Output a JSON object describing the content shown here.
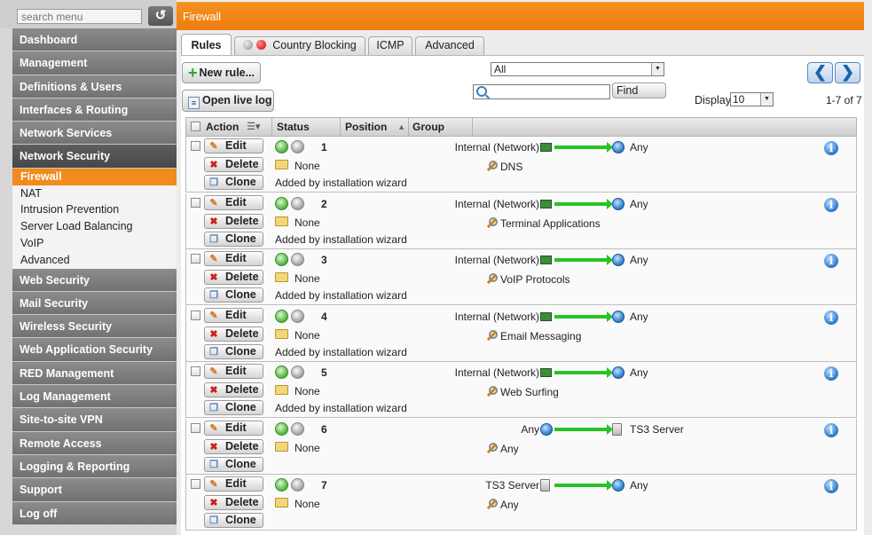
{
  "sidebar": {
    "search_placeholder": "search menu",
    "reset_glyph": "↺",
    "items": [
      {
        "label": "Dashboard"
      },
      {
        "label": "Management"
      },
      {
        "label": "Definitions & Users"
      },
      {
        "label": "Interfaces & Routing"
      },
      {
        "label": "Network Services"
      },
      {
        "label": "Network Security",
        "active": true
      },
      {
        "label": "Web Security"
      },
      {
        "label": "Mail Security"
      },
      {
        "label": "Wireless Security"
      },
      {
        "label": "Web Application Security"
      },
      {
        "label": "RED Management"
      },
      {
        "label": "Log Management"
      },
      {
        "label": "Site-to-site VPN"
      },
      {
        "label": "Remote Access"
      },
      {
        "label": "Logging & Reporting"
      },
      {
        "label": "Support"
      },
      {
        "label": "Log off"
      }
    ],
    "subitems": [
      {
        "label": "Firewall",
        "active": true
      },
      {
        "label": "NAT"
      },
      {
        "label": "Intrusion Prevention"
      },
      {
        "label": "Server Load Balancing"
      },
      {
        "label": "VoIP"
      },
      {
        "label": "Advanced"
      }
    ]
  },
  "page_title": "Firewall",
  "tabs": [
    {
      "label": "Rules",
      "active": true
    },
    {
      "label": "Country Blocking"
    },
    {
      "label": "ICMP"
    },
    {
      "label": "Advanced"
    }
  ],
  "toolbar": {
    "new_rule_label": "New rule...",
    "open_live_log_label": "Open live log",
    "filter_value": "All",
    "search_value": "",
    "find_label": "Find",
    "display_label": "Display:",
    "display_value": "10",
    "pager_range": "1-7 of 7",
    "prev_glyph": "❮",
    "next_glyph": "❯"
  },
  "table": {
    "headers": {
      "action": "Action",
      "status": "Status",
      "position": "Position",
      "group": "Group"
    },
    "row_buttons": {
      "edit": "Edit",
      "delete": "Delete",
      "clone": "Clone"
    },
    "rows": [
      {
        "position": "1",
        "group": "None",
        "source": "Internal (Network)",
        "source_icon": "network-card-icon",
        "destination": "Any",
        "destination_icon": "globe-icon",
        "service": "DNS",
        "note": "Added by installation wizard"
      },
      {
        "position": "2",
        "group": "None",
        "source": "Internal (Network)",
        "source_icon": "network-card-icon",
        "destination": "Any",
        "destination_icon": "globe-icon",
        "service": "Terminal Applications",
        "note": "Added by installation wizard"
      },
      {
        "position": "3",
        "group": "None",
        "source": "Internal (Network)",
        "source_icon": "network-card-icon",
        "destination": "Any",
        "destination_icon": "globe-icon",
        "service": "VoIP Protocols",
        "note": "Added by installation wizard"
      },
      {
        "position": "4",
        "group": "None",
        "source": "Internal (Network)",
        "source_icon": "network-card-icon",
        "destination": "Any",
        "destination_icon": "globe-icon",
        "service": "Email Messaging",
        "note": "Added by installation wizard"
      },
      {
        "position": "5",
        "group": "None",
        "source": "Internal (Network)",
        "source_icon": "network-card-icon",
        "destination": "Any",
        "destination_icon": "globe-icon",
        "service": "Web Surfing",
        "note": "Added by installation wizard"
      },
      {
        "position": "6",
        "group": "None",
        "source": "Any",
        "source_icon": "globe-icon",
        "destination": "TS3 Server",
        "destination_icon": "host-icon",
        "service": "Any",
        "note": ""
      },
      {
        "position": "7",
        "group": "None",
        "source": "TS3 Server",
        "source_icon": "host-icon",
        "destination": "Any",
        "destination_icon": "globe-icon",
        "service": "Any",
        "note": ""
      }
    ]
  },
  "colors": {
    "accent": "#ef8115",
    "sidebar_item": "#7f7f7f",
    "active_subitem": "#f08b1c",
    "rule_arrow": "#27c427"
  }
}
